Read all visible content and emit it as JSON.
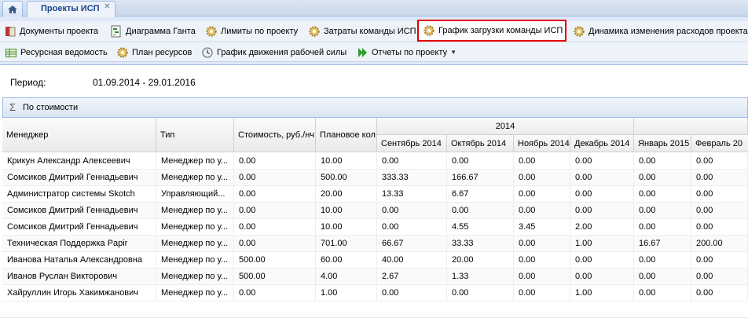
{
  "tabs": {
    "project_tab": "Проекты ИСП"
  },
  "toolbar1": [
    {
      "label": "Документы проекта",
      "icon": "document-icon"
    },
    {
      "label": "Диаграмма Ганта",
      "icon": "gantt-icon"
    },
    {
      "label": "Лимиты по проекту",
      "icon": "gear-icon"
    },
    {
      "label": "Затраты команды ИСП",
      "icon": "gear-icon"
    },
    {
      "label": "График загрузки команды ИСП",
      "icon": "gear-icon"
    },
    {
      "label": "Динамика изменения расходов проекта",
      "icon": "gear-icon"
    }
  ],
  "toolbar2": [
    {
      "label": "Ресурсная ведомость",
      "icon": "table-icon"
    },
    {
      "label": "План ресурсов",
      "icon": "gear-icon"
    },
    {
      "label": "График движения рабочей силы",
      "icon": "clock-icon"
    },
    {
      "label": "Отчеты по проекту",
      "icon": "play-icon"
    }
  ],
  "period": {
    "label": "Период:",
    "value": "01.09.2014 - 29.01.2016"
  },
  "sort": {
    "label": "По стоимости"
  },
  "columns": {
    "manager": "Менеджер",
    "type": "Тип",
    "cost": "Стоимость, руб./нч",
    "planned": "Плановое кол",
    "year": "2014",
    "months": [
      "Сентябрь 2014",
      "Октябрь 2014",
      "Ноябрь 2014",
      "Декабрь 2014",
      "Январь 2015",
      "Февраль 20"
    ]
  },
  "rows": [
    [
      "Крикун Александр Алексеевич",
      "Менеджер по у...",
      "0.00",
      "10.00",
      "0.00",
      "0.00",
      "0.00",
      "0.00",
      "0.00",
      "0.00"
    ],
    [
      "Сомсиков Дмитрий Геннадьевич",
      "Менеджер по у...",
      "0.00",
      "500.00",
      "333.33",
      "166.67",
      "0.00",
      "0.00",
      "0.00",
      "0.00"
    ],
    [
      "Администратор системы Skotch",
      "Управляющий...",
      "0.00",
      "20.00",
      "13.33",
      "6.67",
      "0.00",
      "0.00",
      "0.00",
      "0.00"
    ],
    [
      "Сомсиков Дмитрий Геннадьевич",
      "Менеджер по у...",
      "0.00",
      "10.00",
      "0.00",
      "0.00",
      "0.00",
      "0.00",
      "0.00",
      "0.00"
    ],
    [
      "Сомсиков Дмитрий Геннадьевич",
      "Менеджер по у...",
      "0.00",
      "10.00",
      "0.00",
      "4.55",
      "3.45",
      "2.00",
      "0.00",
      "0.00"
    ],
    [
      "Техническая Поддержка Papir",
      "Менеджер по у...",
      "0.00",
      "701.00",
      "66.67",
      "33.33",
      "0.00",
      "1.00",
      "16.67",
      "200.00"
    ],
    [
      "Иванова Наталья Александровна",
      "Менеджер по у...",
      "500.00",
      "60.00",
      "40.00",
      "20.00",
      "0.00",
      "0.00",
      "0.00",
      "0.00"
    ],
    [
      "Иванов Руслан Викторович",
      "Менеджер по у...",
      "500.00",
      "4.00",
      "2.67",
      "1.33",
      "0.00",
      "0.00",
      "0.00",
      "0.00"
    ],
    [
      "Хайруллин Игорь Хакимжанович",
      "Менеджер по у...",
      "0.00",
      "1.00",
      "0.00",
      "0.00",
      "0.00",
      "1.00",
      "0.00",
      "0.00"
    ]
  ]
}
